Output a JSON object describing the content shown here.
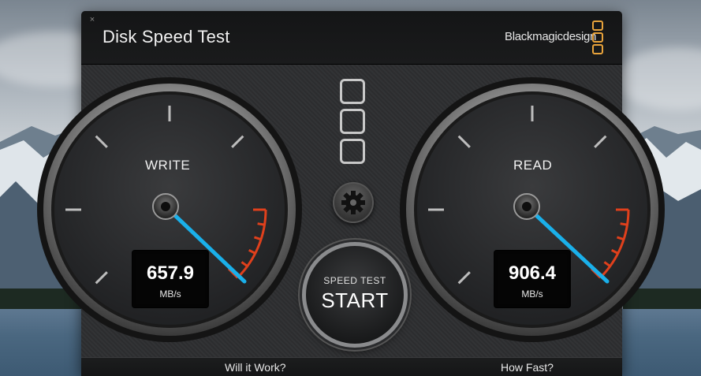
{
  "window": {
    "title": "Disk Speed Test",
    "brand": "Blackmagicdesign",
    "close_symbol": "×"
  },
  "gauges": {
    "write": {
      "label": "WRITE",
      "value": "657.9",
      "unit": "MB/s"
    },
    "read": {
      "label": "READ",
      "value": "906.4",
      "unit": "MB/s"
    }
  },
  "controls": {
    "start_small": "SPEED TEST",
    "start_big": "START",
    "settings_icon": "gear-icon"
  },
  "bottom": {
    "left": "Will it Work?",
    "right": "How Fast?"
  },
  "colors": {
    "needle": "#1ab0ea",
    "redzone": "#e0401c",
    "brand_accent": "#e8a33b"
  }
}
